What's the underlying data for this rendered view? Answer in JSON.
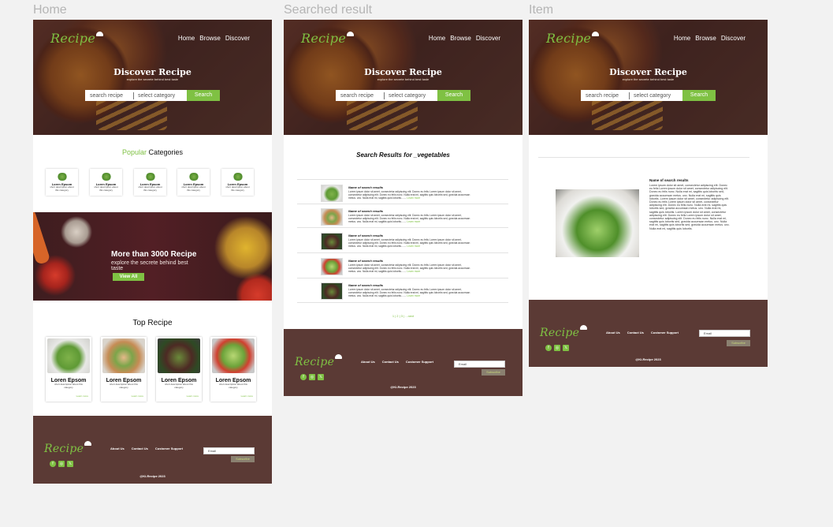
{
  "labels": {
    "home": "Home",
    "searched": "Searched result",
    "item": "Item"
  },
  "brand": {
    "name": "Recipe",
    "green": "#7fc143",
    "footer_bg": "#5b3a35"
  },
  "nav": [
    "Home",
    "Browse",
    "Discover"
  ],
  "hero": {
    "title": "Discover Recipe",
    "subtitle": "explore the secrete behind best taste",
    "search_placeholder": "search recipe",
    "category_placeholder": "select category",
    "search_button": "Search"
  },
  "home": {
    "popular_prefix": "Popular",
    "popular_suffix": "Categories",
    "categories": [
      {
        "title": "Loren Epsom",
        "desc": "short description about this category"
      },
      {
        "title": "Loren Epsom",
        "desc": "short description about this category"
      },
      {
        "title": "Loren Epsom",
        "desc": "short description about this category"
      },
      {
        "title": "Loren Epsom",
        "desc": "short description about this category"
      },
      {
        "title": "Loren Epsom",
        "desc": "short description about this category"
      }
    ],
    "banner_title": "More than 3000 Recipe",
    "banner_sub": "explore the secrete behind best taste",
    "banner_button": "View All",
    "top_title": "Top Recipe",
    "top_recipes": [
      {
        "title": "Loren Epsom",
        "desc": "short description about this category",
        "more": "Learn more"
      },
      {
        "title": "Loren Epsom",
        "desc": "short description about this category",
        "more": "Learn more"
      },
      {
        "title": "Loren Epsom",
        "desc": "short description about this category",
        "more": "Learn more"
      },
      {
        "title": "Loren Epsom",
        "desc": "short description about this category",
        "more": "Learn more"
      }
    ]
  },
  "results": {
    "title": "Search Results for _vegetables",
    "item_name": "Name of search  results",
    "item_text": "Lorem ipsum dolor sit amet, consectetur adipiscing elit. Donec eu felis Lorem ipsum dolor sit amet, consectetur adipiscing elit. Donec eu felis nunc. Nulla erat mi, sagittis quis lobortis sed, gravida accumsan metus. unc. Nulla erat mi, sagittis quis lobortis.......",
    "learn_more": "Learn more",
    "pager": "1 | 2 | 3 | ...next"
  },
  "item": {
    "name": "Name of search  results",
    "text": "Lorem ipsum dolor sit amet, consectetur adipiscing elit. Donec eu felis Lorem ipsum dolor sit amet, consectetur adipiscing elit. Donec eu felis nunc. Nulla erat mi, sagittis quis lobortis sed, gravida accumsan metus. unc. Nulla erat mi, sagittis quis lobortis. Lorem ipsum dolor sit amet, consectetur adipiscing elit. Donec eu felis Lorem ipsum dolor sit amet, consectetur adipiscing elit. Donec eu felis nunc. Nulla erat mi, sagittis quis lobortis sed, gravida accumsan metus. unc. Nulla erat mi, sagittis quis lobortis. Lorem ipsum dolor sit amet, consectetur adipiscing elit. Donec eu felis Lorem ipsum dolor sit amet, consectetur adipiscing elit. Donec eu felis nunc. Nulla erat mi, sagittis quis lobortis sed, gravida accumsan metus. unc. Nulla erat mi, sagittis quis lobortis sed, gravida accumsan metus. unc. Nulla erat mi, sagittis quis lobortis."
  },
  "footer": {
    "links": [
      "About Us",
      "Contact Us",
      "Customer Support"
    ],
    "email_placeholder": "Email",
    "subscribe": "Subscribe",
    "copyright": "@Ki-Recipe 2023",
    "socials": [
      "facebook-icon",
      "instagram-icon",
      "x-icon"
    ],
    "social_glyphs": [
      "f",
      "◎",
      "𝕏"
    ]
  }
}
